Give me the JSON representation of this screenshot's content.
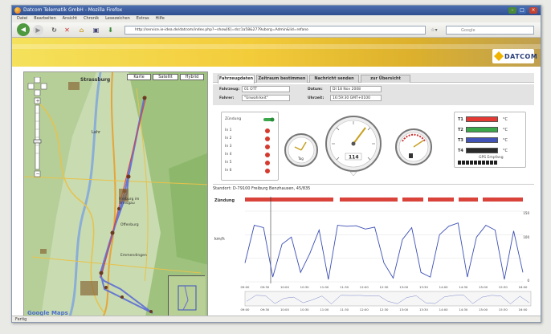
{
  "window": {
    "title": "Datcom Telematik GmbH - Mozilla Firefox"
  },
  "menu": [
    "Datei",
    "Bearbeiten",
    "Ansicht",
    "Chronik",
    "Lesezeichen",
    "Extras",
    "Hilfe"
  ],
  "nav": {
    "url": "http://service.ie-idea.de/datcom/index.php?~show[6]=dcc1a58&2779ubsrg=Admin&lid=refano",
    "search_placeholder": "Google"
  },
  "brand": {
    "logo": "DATCOM"
  },
  "map": {
    "type_buttons": [
      "Karte",
      "Satellit",
      "Hybrid"
    ],
    "labels": [
      "Strassburg",
      "Lahr",
      "Freiburg im Breisgau",
      "Offenburg",
      "Emmendingen"
    ],
    "credit": "Google Maps"
  },
  "tabs": [
    "Fahrzeugdaten",
    "Zeitraum bestimmen",
    "Nachricht senden",
    "zur Übersicht"
  ],
  "info": {
    "fahrzeug_label": "Fahrzeug:",
    "fahrzeug_value": "01 OTT",
    "fahrer_label": "Fahrer:",
    "fahrer_value": "\"Unwahrkeit\"",
    "datum_label": "Datum:",
    "datum_value": "DI 18 Nov 2008",
    "uhrzeit_label": "Uhrzeit:",
    "uhrzeit_value": "16:59:30 GMT+0100",
    "gps_text": "GPS Empfang"
  },
  "status": {
    "zuendung": "Zündung",
    "inputs": [
      "In 1",
      "In 2",
      "In 3",
      "In 4",
      "In 5",
      "In 6"
    ]
  },
  "gauges": {
    "speed": "114",
    "time": "Tag"
  },
  "temps": [
    {
      "label": "T1",
      "unit": "°C",
      "color": "#e53a33"
    },
    {
      "label": "T2",
      "unit": "°C",
      "color": "#3aa84a"
    },
    {
      "label": "T3",
      "unit": "°C",
      "color": "#4253b8"
    },
    {
      "label": "T4",
      "unit": "°C",
      "color": "#2a2a2a"
    }
  ],
  "standort": "Standort: D-79100 Freiburg Benzhausen, 45/835",
  "chart_labels": {
    "zuendung": "Zündung",
    "speed_unit": "km/h",
    "y_max": "150",
    "y_mid": "100",
    "y_min": "0"
  },
  "chart_data": {
    "type": "line",
    "ylabel": "km/h",
    "ylim": [
      0,
      150
    ],
    "x": [
      "09:00",
      "09:30",
      "10:00",
      "10:30",
      "11:00",
      "11:30",
      "12:00",
      "12:30",
      "13:00",
      "13:30",
      "14:00",
      "14:30",
      "15:00",
      "15:30",
      "16:00"
    ],
    "series": [
      {
        "values": [
          40,
          120,
          115,
          10,
          80,
          95,
          20,
          60,
          110,
          5,
          120,
          118,
          119,
          112,
          116,
          40,
          8,
          90,
          115,
          20,
          10,
          100,
          118,
          125,
          10,
          95,
          120,
          110,
          5,
          108,
          20
        ]
      }
    ]
  },
  "statusbar": "Fertig"
}
